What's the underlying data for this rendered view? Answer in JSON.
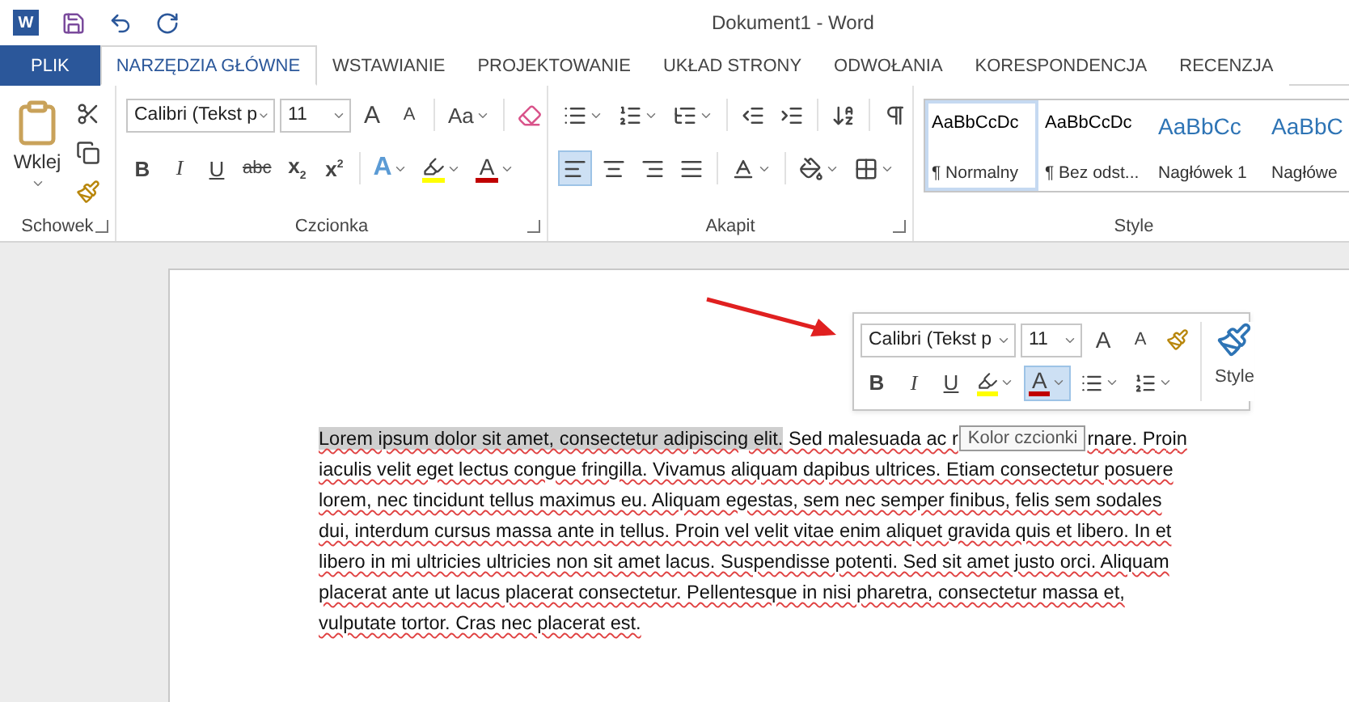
{
  "title_bar": {
    "app_letter": "W",
    "title": "Dokument1 - Word"
  },
  "tabs": [
    {
      "label": "PLIK",
      "kind": "file",
      "selected": false
    },
    {
      "label": "NARZĘDZIA GŁÓWNE",
      "kind": "tab",
      "selected": true
    },
    {
      "label": "WSTAWIANIE",
      "kind": "tab",
      "selected": false
    },
    {
      "label": "PROJEKTOWANIE",
      "kind": "tab",
      "selected": false
    },
    {
      "label": "UKŁAD STRONY",
      "kind": "tab",
      "selected": false
    },
    {
      "label": "ODWOŁANIA",
      "kind": "tab",
      "selected": false
    },
    {
      "label": "KORESPONDENCJA",
      "kind": "tab",
      "selected": false
    },
    {
      "label": "RECENZJA",
      "kind": "tab",
      "selected": false
    }
  ],
  "clipboard": {
    "paste_label": "Wklej",
    "group_label": "Schowek"
  },
  "font": {
    "font_name": "Calibri (Tekst p",
    "font_size": "11",
    "grow_glyph": "A",
    "shrink_glyph": "A",
    "case_glyph": "Aa",
    "format_buttons": [
      {
        "kind": "bold",
        "glyph": "B"
      },
      {
        "kind": "italic",
        "glyph": "I"
      },
      {
        "kind": "underline",
        "glyph": "U"
      },
      {
        "kind": "strike",
        "glyph": "abc"
      },
      {
        "kind": "sub",
        "glyph": "x",
        "mark": "2"
      },
      {
        "kind": "sup",
        "glyph": "x",
        "mark": "2"
      }
    ],
    "effects_glyph": "A",
    "color_glyph": "A",
    "group_label": "Czcionka"
  },
  "paragraph": {
    "alignments": [
      {
        "kind": "left",
        "selected": true
      },
      {
        "kind": "center",
        "selected": false
      },
      {
        "kind": "right",
        "selected": false
      },
      {
        "kind": "justify",
        "selected": false
      }
    ],
    "group_label": "Akapit"
  },
  "styles": {
    "items": [
      {
        "preview": "AaBbCcDc",
        "name": "¶ Normalny",
        "kind": "body",
        "selected": true
      },
      {
        "preview": "AaBbCcDc",
        "name": "¶ Bez odst...",
        "kind": "body",
        "selected": false
      },
      {
        "preview": "AaBbCc",
        "name": "Nagłówek 1",
        "kind": "heading",
        "selected": false
      },
      {
        "preview": "AaBbC",
        "name": "Nagłówe",
        "kind": "heading",
        "selected": false
      }
    ],
    "group_label": "Style"
  },
  "mini_toolbar": {
    "font_name": "Calibri (Tekst p",
    "font_size": "11",
    "grow_glyph": "A",
    "shrink_glyph": "A",
    "format_buttons": [
      {
        "kind": "bold",
        "glyph": "B"
      },
      {
        "kind": "italic",
        "glyph": "I"
      },
      {
        "kind": "underline",
        "glyph": "U"
      }
    ],
    "color_glyph": "A",
    "color_hovered": true,
    "styles_label": "Style"
  },
  "tooltip": "Kolor czcionki",
  "document": {
    "lines": [
      {
        "selected_text": "Lorem ipsum dolor sit amet, consectetur adipiscing elit.",
        "before_tooltip": " Sed malesuada ac r",
        "after_tooltip": "rnare. Proin"
      },
      {
        "text": "iaculis velit eget lectus congue fringilla. Vivamus aliquam dapibus ultrices. Etiam consectetur posuere"
      },
      {
        "text": "lorem, nec tincidunt tellus maximus eu. Aliquam egestas, sem nec semper finibus, felis sem sodales"
      },
      {
        "text": "dui, interdum cursus massa ante in tellus. Proin vel velit vitae enim aliquet gravida quis et libero. In et"
      },
      {
        "text": "libero in mi ultricies ultricies non sit amet lacus. Suspendisse potenti. Sed sit amet justo orci. Aliquam"
      },
      {
        "text": "placerat ante ut lacus placerat consectetur. Pellentesque in nisi pharetra, consectetur massa et,"
      },
      {
        "text": "vulputate tortor. Cras nec placerat est."
      }
    ]
  }
}
